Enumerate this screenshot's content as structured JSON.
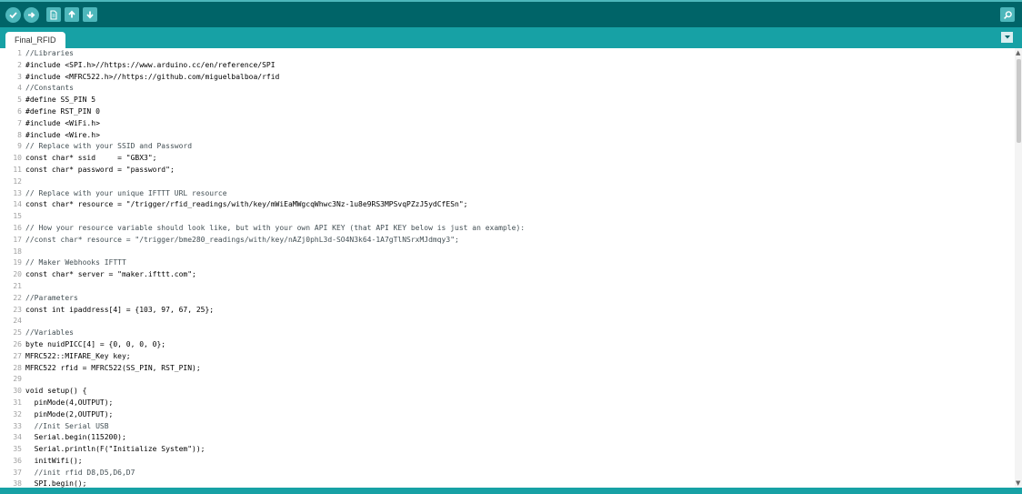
{
  "toolbar": {
    "buttons": [
      {
        "name": "verify-button",
        "icon": "checkmark-icon"
      },
      {
        "name": "upload-button",
        "icon": "arrow-right-icon"
      },
      {
        "name": "new-button",
        "icon": "document-icon"
      },
      {
        "name": "open-button",
        "icon": "arrow-up-icon"
      },
      {
        "name": "save-button",
        "icon": "arrow-down-icon"
      }
    ],
    "serial_monitor_icon": "magnifier-icon"
  },
  "tabs": [
    {
      "label": "Final_RFID",
      "active": true
    }
  ],
  "colors": {
    "toolbar": "#006468",
    "tabbar": "#17a1a5",
    "button": "#4db7bb",
    "comment": "#434f54",
    "type": "#00979c",
    "function": "#d35400"
  },
  "code_lines": [
    "//Libraries",
    "#include <SPI.h>//https://www.arduino.cc/en/reference/SPI",
    "#include <MFRC522.h>//https://github.com/miguelbalboa/rfid",
    "//Constants",
    "#define SS_PIN 5",
    "#define RST_PIN 0",
    "#include <WiFi.h>",
    "#include <Wire.h>",
    "// Replace with your SSID and Password",
    "const char* ssid     = \"GBX3\";",
    "const char* password = \"password\";",
    "",
    "// Replace with your unique IFTTT URL resource",
    "const char* resource = \"/trigger/rfid_readings/with/key/mWiEaMWgcqWhwc3Nz-1u8e9RS3MPSvqPZzJ5ydCfESn\";",
    "",
    "// How your resource variable should look like, but with your own API KEY (that API KEY below is just an example):",
    "//const char* resource = \"/trigger/bme280_readings/with/key/nAZj0phL3d-SO4N3k64-1A7gTlNSrxMJdmqy3\";",
    "",
    "// Maker Webhooks IFTTT",
    "const char* server = \"maker.ifttt.com\";",
    "",
    "//Parameters",
    "const int ipaddress[4] = {103, 97, 67, 25};",
    "",
    "//Variables",
    "byte nuidPICC[4] = {0, 0, 0, 0};",
    "MFRC522::MIFARE_Key key;",
    "MFRC522 rfid = MFRC522(SS_PIN, RST_PIN);",
    "",
    "void setup() {",
    "  pinMode(4,OUTPUT);",
    "  pinMode(2,OUTPUT);",
    "  //Init Serial USB",
    "  Serial.begin(115200);",
    "  Serial.println(F(\"Initialize System\"));",
    "  initWifi();",
    "  //init rfid D8,D5,D6,D7",
    "  SPI.begin();"
  ]
}
